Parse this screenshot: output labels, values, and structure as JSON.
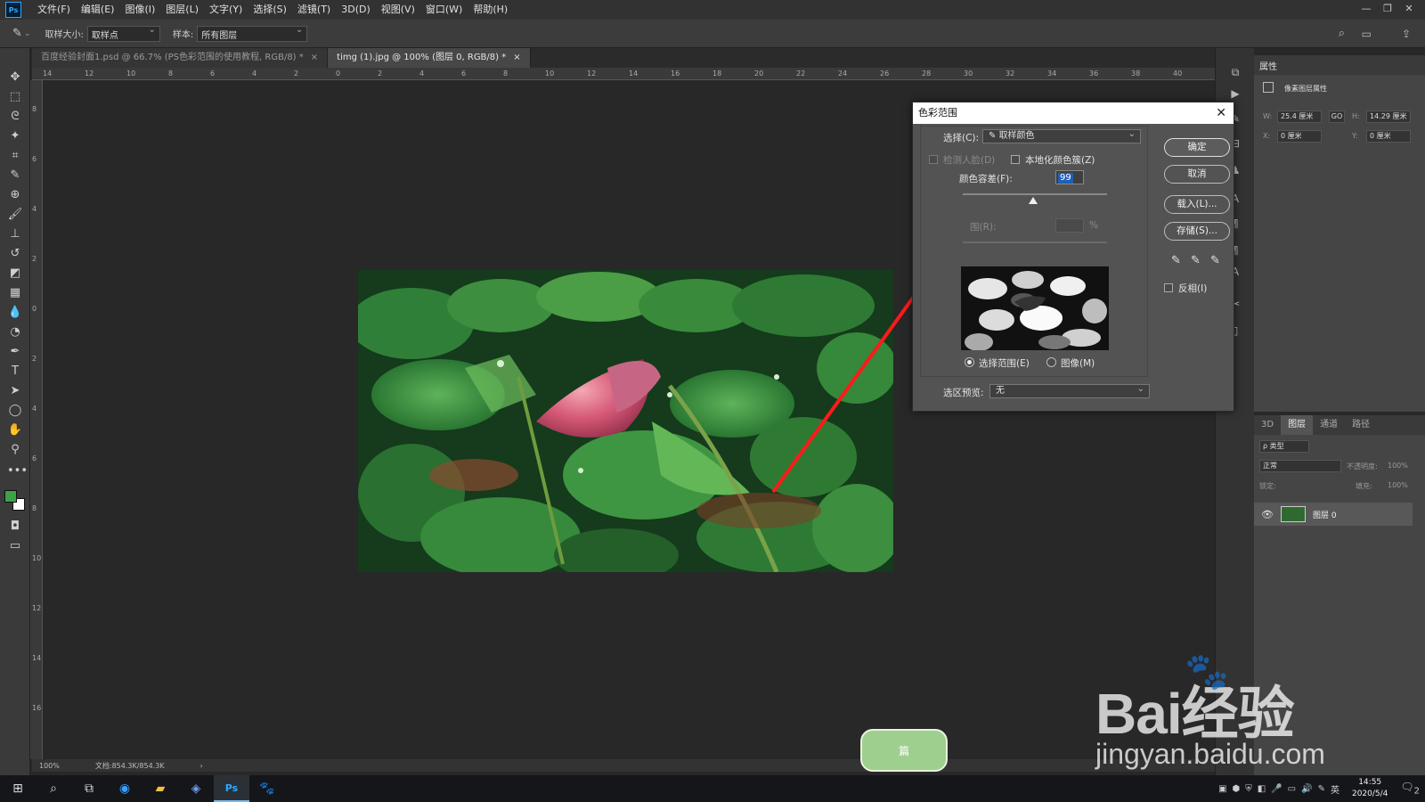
{
  "menubar": {
    "logo": "Ps",
    "items": [
      "文件(F)",
      "编辑(E)",
      "图像(I)",
      "图层(L)",
      "文字(Y)",
      "选择(S)",
      "滤镜(T)",
      "3D(D)",
      "视图(V)",
      "窗口(W)",
      "帮助(H)"
    ]
  },
  "options": {
    "sample_size_label": "取样大小:",
    "sample_size_value": "取样点",
    "sample_label": "样本:",
    "sample_value": "所有图层"
  },
  "tabs": [
    {
      "label": "百度经验封面1.psd @ 66.7% (PS色彩范围的使用教程, RGB/8) *",
      "close": "×"
    },
    {
      "label": "timg (1).jpg @ 100% (图层 0, RGB/8) *",
      "close": "×"
    }
  ],
  "ruler_top_ticks": [
    "14",
    "12",
    "10",
    "8",
    "6",
    "4",
    "2",
    "0",
    "2",
    "4",
    "6",
    "8",
    "10",
    "12",
    "14",
    "16",
    "18",
    "20",
    "22",
    "24",
    "26",
    "28",
    "30",
    "32",
    "34",
    "36",
    "38",
    "40"
  ],
  "ruler_left_ticks": [
    "8",
    "6",
    "4",
    "2",
    "0",
    "2",
    "4",
    "6",
    "8",
    "10",
    "12",
    "14",
    "16"
  ],
  "status": {
    "zoom": "100%",
    "doc": "文档:854.3K/854.3K"
  },
  "properties": {
    "tab": "属性",
    "section": "像素图层属性",
    "w_label": "W:",
    "w_value": "25.4 厘米",
    "link_label": "GO",
    "h_label": "H:",
    "h_value": "14.29 厘米",
    "x_label": "X:",
    "x_value": "0 厘米",
    "y_label": "Y:",
    "y_value": "0 厘米"
  },
  "layers_panel": {
    "tabs": [
      "3D",
      "图层",
      "通道",
      "路径"
    ],
    "active_tab": "图层",
    "kind_placeholder": "ρ 类型",
    "blend_mode": "正常",
    "opacity_label": "不透明度:",
    "opacity_value": "100%",
    "lock_label": "锁定:",
    "fill_label": "填充:",
    "fill_value": "100%",
    "layer_name": "图层 0"
  },
  "dialog": {
    "title": "色彩范围",
    "select_label": "选择(C):",
    "select_value": "取样颜色",
    "detect_faces": "检测人脸(D)",
    "localized": "本地化颜色簇(Z)",
    "fuzziness_label": "颜色容差(F):",
    "fuzziness_value": "99",
    "range_label": "范围(R):",
    "range_label_visible": "围(R):",
    "range_unit": "%",
    "radio_selection": "选择范围(E)",
    "radio_image": "图像(M)",
    "preview_label": "选区预览:",
    "preview_value": "无",
    "ok": "确定",
    "cancel": "取消",
    "load": "载入(L)...",
    "save": "存储(S)...",
    "invert": "反相(I)",
    "eyedropper_icons": [
      "eyedropper-icon",
      "eyedropper-plus-icon",
      "eyedropper-minus-icon"
    ]
  },
  "taskbar": {
    "time": "14:55",
    "date": "2020/5/4",
    "lang": "英",
    "notif_count": "2"
  },
  "watermark": {
    "brand_text": "Bai经验",
    "url": "jingyan.baidu.com",
    "badge": "篇"
  },
  "colors": {
    "arrow": "#ff1a1a",
    "fg_swatch": "#3aa34a",
    "bg_swatch": "#ffffff",
    "highlight": "#1f5fb8"
  }
}
